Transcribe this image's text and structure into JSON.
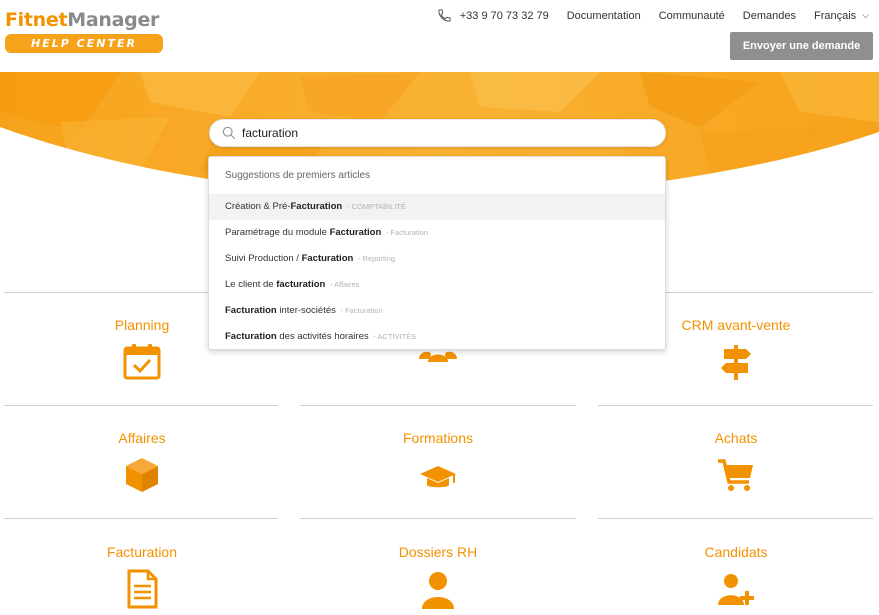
{
  "brand": {
    "logo_part1": "Fitnet",
    "logo_part2": "Manager",
    "logo_badge": "HELP CENTER",
    "accent": "#f39200",
    "button_gray": "#8f8f8f"
  },
  "topnav": {
    "phone_icon": "phone-icon",
    "phone": "+33 9 70 73 32 79",
    "documentation": "Documentation",
    "community": "Communauté",
    "requests": "Demandes",
    "language": "Français",
    "send_request": "Envoyer une demande"
  },
  "search": {
    "value": "facturation",
    "icon": "search-icon"
  },
  "suggestions": {
    "title": "Suggestions de premiers articles",
    "items": [
      {
        "pre": "Création & Pré-",
        "bold": "Facturation",
        "post": "",
        "category": "- COMPTABILITÉ"
      },
      {
        "pre": "Paramétrage du module ",
        "bold": "Facturation",
        "post": "",
        "category": "- Facturation"
      },
      {
        "pre": "Suivi Production / ",
        "bold": "Facturation",
        "post": "",
        "category": "- Reporting"
      },
      {
        "pre": "Le client de ",
        "bold": "facturation",
        "post": "",
        "category": "- Affaires"
      },
      {
        "pre": "",
        "bold": "Facturation",
        "post": " inter-sociétés",
        "category": "- Facturation"
      },
      {
        "pre": "",
        "bold": "Facturation",
        "post": " des activités horaires",
        "category": "- ACTIVITÉS"
      }
    ]
  },
  "categories": [
    {
      "title": "Planning",
      "icon": "calendar-check-icon"
    },
    {
      "title": "",
      "icon": "users-group-icon"
    },
    {
      "title": "CRM avant-vente",
      "icon": "signpost-icon"
    },
    {
      "title": "Affaires",
      "icon": "cube-icon"
    },
    {
      "title": "Formations",
      "icon": "graduation-cap-icon"
    },
    {
      "title": "Achats",
      "icon": "shopping-cart-icon"
    },
    {
      "title": "Facturation",
      "icon": "document-icon"
    },
    {
      "title": "Dossiers RH",
      "icon": "user-icon"
    },
    {
      "title": "Candidats",
      "icon": "user-plus-icon"
    }
  ]
}
